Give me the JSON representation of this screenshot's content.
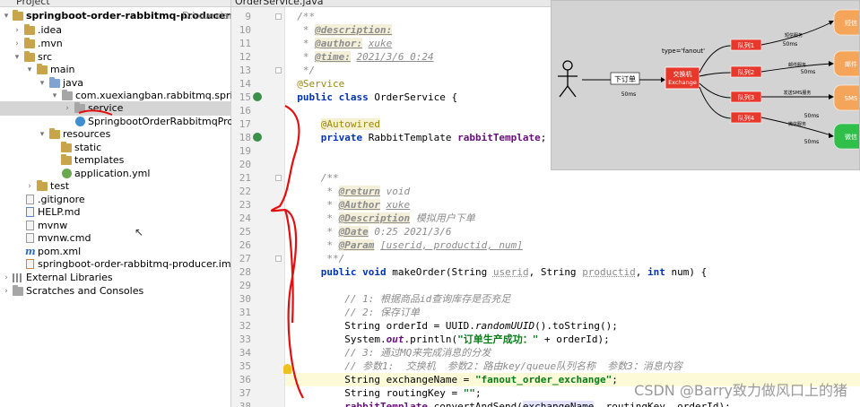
{
  "project_panel": {
    "title": "Project",
    "tree": [
      {
        "label": "springboot-order-rabbitmq-producer",
        "suffix": "D:\\xuexiangb",
        "bold": true
      },
      {
        "label": ".idea"
      },
      {
        "label": ".mvn"
      },
      {
        "label": "src"
      },
      {
        "label": "main"
      },
      {
        "label": "java"
      },
      {
        "label": "com.xuexiangban.rabbitmq.springbootor"
      },
      {
        "label": "service"
      },
      {
        "label": "SpringbootOrderRabbitmqProducerAp"
      },
      {
        "label": "resources"
      },
      {
        "label": "static"
      },
      {
        "label": "templates"
      },
      {
        "label": "application.yml"
      },
      {
        "label": "test"
      },
      {
        "label": ".gitignore"
      },
      {
        "label": "HELP.md"
      },
      {
        "label": "mvnw"
      },
      {
        "label": "mvnw.cmd"
      },
      {
        "label": "pom.xml"
      },
      {
        "label": "springboot-order-rabbitmq-producer.iml"
      },
      {
        "label": "External Libraries"
      },
      {
        "label": "Scratches and Consoles"
      }
    ]
  },
  "editor": {
    "tab_label": "OrderService.java",
    "line_numbers": [
      "9",
      "10",
      "11",
      "12",
      "13",
      "14",
      "15",
      "16",
      "17",
      "18",
      "19",
      "20",
      "21",
      "22",
      "23",
      "24",
      "25",
      "26",
      "27",
      "28",
      "29",
      "30",
      "31",
      "32",
      "33",
      "34",
      "35",
      "36",
      "37",
      "38"
    ],
    "code": {
      "l9": "/**",
      "l10_tag": "@description:",
      "l11_tag": "@author:",
      "l11_val": "xuke",
      "l12_tag": "@time:",
      "l12_val": "2021/3/6 0:24",
      "l13": "*/",
      "l14": "@Service",
      "l15_kw": "public class",
      "l15_name": "OrderService {",
      "l17": "@Autowired",
      "l18_kw": "private",
      "l18_type": "RabbitTemplate",
      "l18_field": "rabbitTemplate",
      "l21": "/**",
      "l22_tag": "@return",
      "l22_val": "void",
      "l23_tag": "@Author",
      "l23_val": "xuke",
      "l24_tag": "@Description",
      "l24_val": "模拟用户下单",
      "l25_tag": "@Date",
      "l25_val": "0:25 2021/3/6",
      "l26_tag": "@Param",
      "l26_val": "[userid, productid, num]",
      "l27": "**/",
      "l28_kw1": "public void",
      "l28_name": "makeOrder(String",
      "l28_p1": "userid",
      "l28_mid": ", String",
      "l28_p2": "productid",
      "l28_mid2": ",",
      "l28_kw2": "int",
      "l28_end": "num) {",
      "l30": "// 1: 根据商品id查询库存是否充足",
      "l31": "// 2: 保存订单",
      "l32_a": "String orderId = UUID.",
      "l32_b": "randomUUID",
      "l32_c": "().toString();",
      "l33_a": "System.",
      "l33_out": "out",
      "l33_b": ".println(",
      "l33_str": "\"订单生产成功：\"",
      "l33_c": " + orderId);",
      "l34": "// 3: 通过MQ来完成消息的分发",
      "l35": "// 参数1:  交换机  参数2：路由key/queue队列名称  参数3：消息内容",
      "l36_a": "String exchangeName = ",
      "l36_str": "\"fanout_order_exchange\"",
      "l36_c": ";",
      "l37_a": "String routingKey = ",
      "l37_str": "\"\"",
      "l37_c": ";",
      "l38_field": "rabbitTemplate",
      "l38_a": ".convertAndSend(",
      "l38_hl": "exchangeName",
      "l38_c": ", routingKey, orderId);"
    }
  },
  "diagram": {
    "type_label": "type='fanout'",
    "order_label": "下订单",
    "exchange_label_1": "交换机",
    "exchange_label_2": "Exchange",
    "queues": [
      "队列1",
      "队列2",
      "队列3",
      "队列4"
    ],
    "small_labels": [
      "短信服务",
      "邮件服务",
      "发送SMS服务",
      "微信服务"
    ],
    "time_labels": [
      "50ms",
      "50ms",
      "50ms",
      "50ms",
      "50ms"
    ],
    "consumers": [
      "短信",
      "邮件",
      "SMS",
      "微信"
    ],
    "colors": {
      "background": "#d3d3d3",
      "red_box": "#e8382c",
      "orange_box": "#f5a55a",
      "green_box": "#2fbf4a"
    }
  },
  "watermark": "CSDN @Barry致力做风口上的猪"
}
